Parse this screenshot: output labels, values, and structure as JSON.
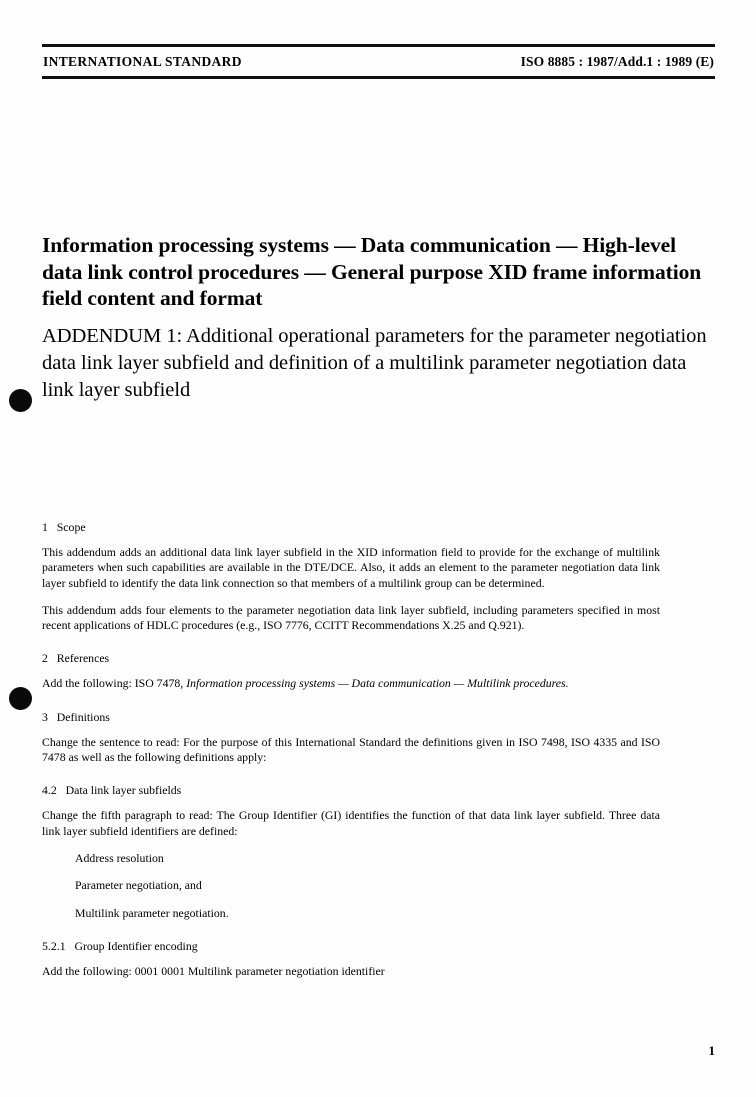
{
  "header": {
    "left_text": "INTERNATIONAL STANDARD",
    "right_text": "ISO 8885 : 1987/Add.1 : 1989 (E)"
  },
  "title": {
    "main": "Information processing systems — Data communication — High-level data link control procedures — General purpose XID frame information field content and format",
    "addendum": "ADDENDUM 1: Additional operational parameters for the parameter negotiation data link layer subfield and definition of a multilink parameter negotiation data link layer subfield"
  },
  "clauses": {
    "scope": {
      "number_and_title": "1   Scope",
      "paragraph_1": "This addendum adds an additional data link layer subfield in the XID information field to provide for the exchange of multilink parameters when such capabilities are available in the DTE/DCE.  Also, it adds an element to the parameter negotiation data link layer subfield to identify the data link connection so that members of a multilink group can be determined.",
      "paragraph_2": "This addendum adds four elements to the parameter negotiation data link layer subfield, including parameters specified in most recent applications of HDLC procedures (e.g., ISO 7776, CCITT Recommendations X.25 and Q.921)."
    },
    "references": {
      "number_and_title": "2   References",
      "lead_in": "Add the following: ISO 7478, ",
      "italic_title": "Information processing systems — Data communication — Multilink procedures."
    },
    "definitions": {
      "number_and_title": "3   Definitions",
      "paragraph_1": "Change the sentence to read: For the purpose of this International Standard the definitions given in ISO 7498, ISO 4335 and ISO 7478 as well as the following definitions apply:"
    },
    "data_link_layer_subfields": {
      "number_and_title": "4.2   Data link layer subfields",
      "paragraph_1": "Change the fifth paragraph to read: The Group Identifier (GI) identifies the function of that data link layer subfield.  Three data link layer subfield identifiers are defined:",
      "items": [
        "Address resolution",
        "Parameter negotiation, and",
        "Multilink parameter negotiation."
      ]
    },
    "group_identifier_encoding": {
      "number_and_title": "5.2.1   Group Identifier encoding",
      "paragraph_1": "Add the following:  0001 0001 Multilink parameter negotiation identifier"
    }
  },
  "folio": {
    "page_number": "1"
  },
  "colors": {
    "text": "#000000",
    "rule": "#111111",
    "page_background": "#fefefe"
  }
}
